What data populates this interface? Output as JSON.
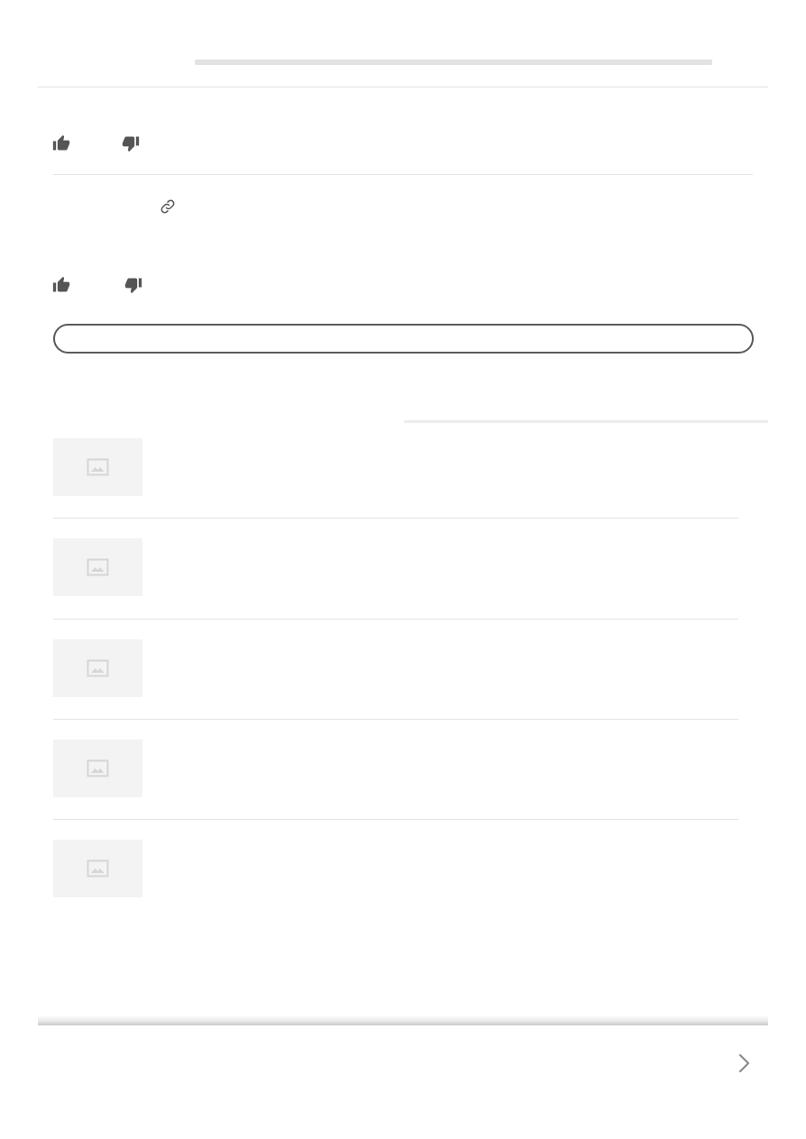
{
  "header": {
    "title_placeholder": ""
  },
  "feedback": [
    {
      "like_icon": "thumbs-up-icon",
      "dislike_icon": "thumbs-down-icon"
    },
    {
      "like_icon": "thumbs-up-icon",
      "dislike_icon": "thumbs-down-icon"
    }
  ],
  "link_icon": "link-icon",
  "more_button": {
    "label": ""
  },
  "related": {
    "items": [
      {
        "title": "",
        "thumbnail_icon": "image-placeholder-icon"
      },
      {
        "title": "",
        "thumbnail_icon": "image-placeholder-icon"
      },
      {
        "title": "",
        "thumbnail_icon": "image-placeholder-icon"
      },
      {
        "title": "",
        "thumbnail_icon": "image-placeholder-icon"
      },
      {
        "title": "",
        "thumbnail_icon": "image-placeholder-icon"
      }
    ]
  },
  "footer": {
    "next_icon": "chevron-right-icon"
  },
  "colors": {
    "skeleton": "#e2e2e2",
    "divider": "#e3e3e3",
    "icon": "#555555",
    "thumbnail_bg": "#f3f3f3",
    "thumbnail_icon": "#dadada"
  }
}
